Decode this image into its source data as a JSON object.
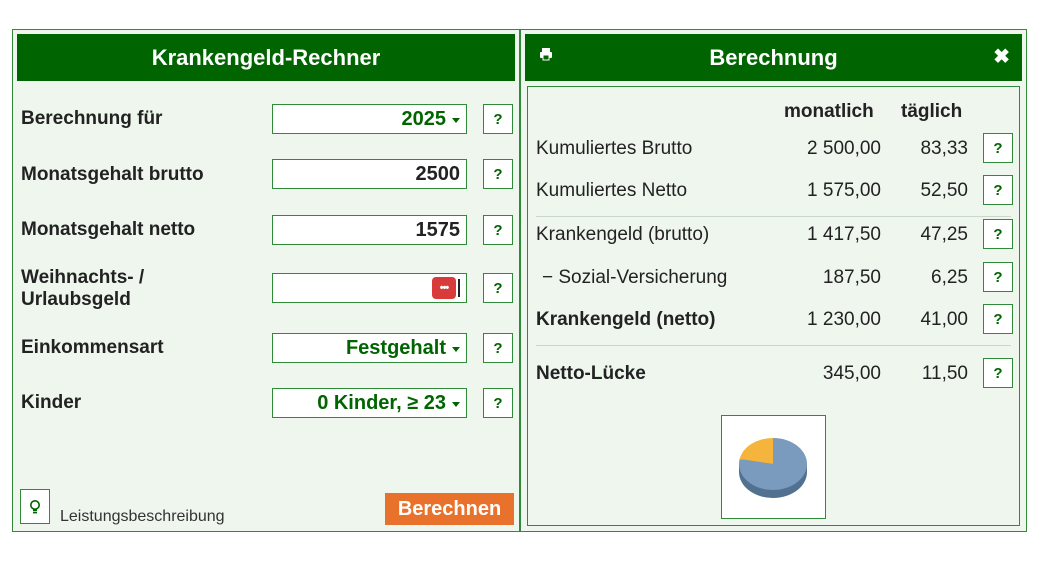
{
  "left": {
    "title": "Krankengeld-Rechner",
    "rows": [
      {
        "label": "Berechnung für",
        "value": "2025",
        "type": "select"
      },
      {
        "label": "Monatsgehalt brutto",
        "value": "2500",
        "type": "input"
      },
      {
        "label": "Monatsgehalt netto",
        "value": "1575",
        "type": "input"
      },
      {
        "label_line1": "Weihnachts- /",
        "label_line2": "Urlaubsgeld",
        "value": "",
        "type": "input"
      },
      {
        "label": "Einkommensart",
        "value": "Festgehalt",
        "type": "select"
      },
      {
        "label": "Kinder",
        "value": "0 Kinder, ≥ 23",
        "type": "select"
      }
    ],
    "help_label": "?",
    "pwd_icon_text": "•••",
    "description_link": "Leistungsbeschreibung",
    "calc_button": "Berechnen"
  },
  "right": {
    "title": "Berechnung",
    "close_glyph": "✖",
    "columns": {
      "monthly": "monatlich",
      "daily": "täglich"
    },
    "rows": [
      {
        "label": "Kumuliertes Brutto",
        "monthly": "2 500,00",
        "daily": "83,33",
        "bold": false
      },
      {
        "label": "Kumuliertes Netto",
        "monthly": "1 575,00",
        "daily": "52,50",
        "bold": false
      },
      {
        "label": "Krankengeld (brutto)",
        "monthly": "1 417,50",
        "daily": "47,25",
        "bold": false
      },
      {
        "label": "− Sozial-Versicherung",
        "monthly": "187,50",
        "daily": "6,25",
        "bold": false
      },
      {
        "label": "Krankengeld (netto)",
        "monthly": "1 230,00",
        "daily": "41,00",
        "bold": true
      },
      {
        "label": "Netto-Lücke",
        "monthly": "345,00",
        "daily": "11,50",
        "bold": true
      }
    ],
    "pie": {
      "netto": 1230.0,
      "luecke": 345.0,
      "colors": {
        "netto": "#7a9bbd",
        "luecke": "#f5b43c"
      }
    }
  },
  "colors": {
    "header": "#006400",
    "accent": "#e8712b",
    "panel_bg": "#eef6ee",
    "border": "#2f8a3a"
  },
  "icons": {
    "print": "print-icon",
    "close": "close-icon",
    "bulb": "lightbulb-icon",
    "caret": "chevron-down-icon"
  }
}
